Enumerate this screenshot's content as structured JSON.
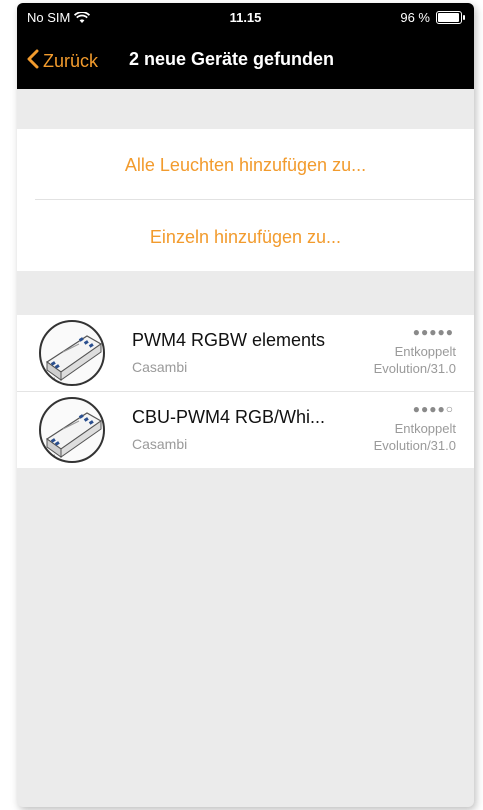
{
  "status_bar": {
    "carrier": "No SIM",
    "time": "11.15",
    "battery": "96 %",
    "battery_level": 0.96
  },
  "nav": {
    "back_label": "Zurück",
    "title": "2 neue Geräte gefunden"
  },
  "actions": {
    "add_all": "Alle Leuchten hinzufügen zu...",
    "add_single": "Einzeln hinzufügen zu..."
  },
  "devices": [
    {
      "name": "PWM4 RGBW elements",
      "vendor": "Casambi",
      "signal": "●●●●●",
      "status": "Entkoppelt",
      "firmware": "Evolution/31.0"
    },
    {
      "name": "CBU-PWM4 RGB/Whi...",
      "vendor": "Casambi",
      "signal": "●●●●○",
      "status": "Entkoppelt",
      "firmware": "Evolution/31.0"
    }
  ],
  "colors": {
    "accent": "#f29b2d",
    "bar": "#000000",
    "background": "#ebebeb"
  }
}
